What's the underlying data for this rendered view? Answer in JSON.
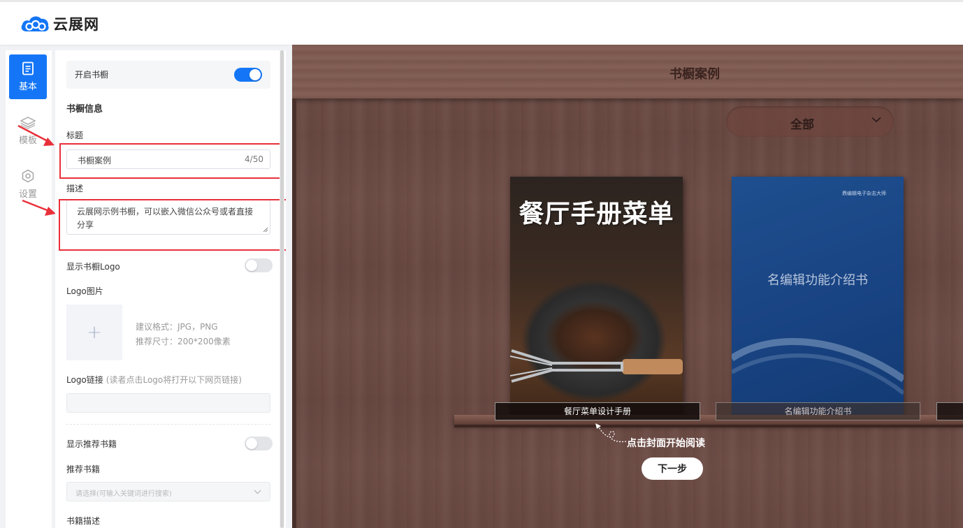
{
  "app": {
    "brand_name": "云展网"
  },
  "nav": {
    "items": [
      {
        "label": "基本",
        "icon": "document-icon",
        "active": true
      },
      {
        "label": "模板",
        "icon": "layers-icon",
        "active": false
      },
      {
        "label": "设置",
        "icon": "hex-gear-icon",
        "active": false
      }
    ]
  },
  "panel": {
    "enable_bookcase_label": "开启书橱",
    "enable_bookcase_on": true,
    "section_title": "书橱信息",
    "title_label": "标题",
    "title_value": "书橱案例",
    "title_counter": "4/50",
    "desc_label": "描述",
    "desc_value": "云展网示例书橱，可以嵌入微信公众号或者直接分享",
    "show_logo_label": "显示书橱Logo",
    "show_logo_on": false,
    "logo_image_label": "Logo图片",
    "logo_add_glyph": "+",
    "logo_format_hint": "建议格式：JPG，PNG",
    "logo_size_hint": "推荐尺寸：200*200像素",
    "logo_link_label": "Logo链接",
    "logo_link_hint": "(读者点击Logo将打开以下网页链接)",
    "show_recommend_label": "显示推荐书籍",
    "show_recommend_on": false,
    "recommend_label": "推荐书籍",
    "recommend_placeholder": "请选择(可输入关键词进行搜索)",
    "book_desc_label": "书籍描述"
  },
  "preview": {
    "shelf_title": "书橱案例",
    "category_selected": "全部",
    "books": [
      {
        "cover_title": "餐厅手册菜单",
        "label": "餐厅菜单设计手册",
        "highlighted": true
      },
      {
        "cover_title": "名编辑功能介绍书",
        "cover_publisher": "鼎编辑电子杂志大师",
        "label": "名编辑功能介绍书",
        "highlighted": false
      }
    ],
    "hint_text": "点击封面开始阅读",
    "next_button": "下一步"
  },
  "colors": {
    "accent": "#1476f6",
    "annotation_red": "#e8303a",
    "wood": "#6b4a43"
  }
}
